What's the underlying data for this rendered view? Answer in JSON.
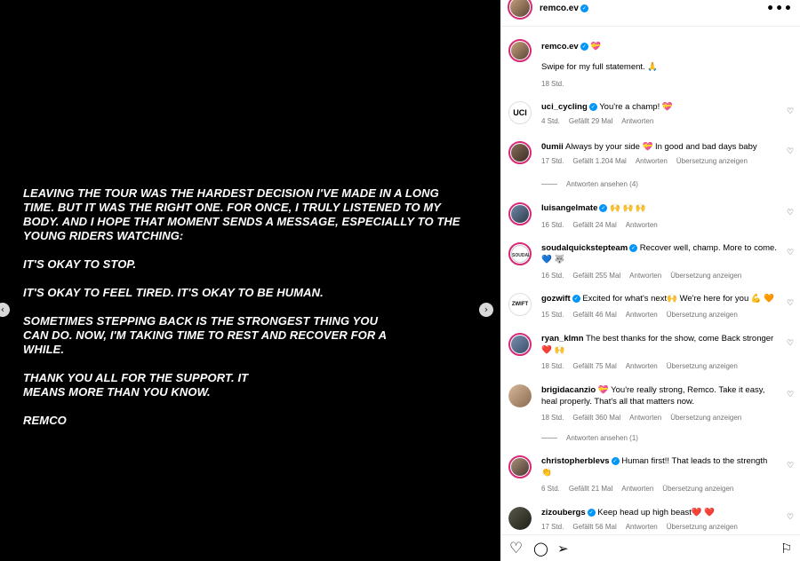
{
  "post": {
    "statement": [
      "LEAVING THE TOUR WAS THE HARDEST DECISION I'VE MADE IN A LONG TIME. BUT IT WAS THE RIGHT ONE. FOR ONCE, I TRULY LISTENED TO MY BODY. AND I HOPE THAT MOMENT SENDS A MESSAGE, ESPECIALLY TO THE YOUNG RIDERS WATCHING:",
      "IT'S OKAY TO STOP.",
      "IT'S OKAY TO FEEL TIRED. IT'S OKAY TO BE HUMAN.",
      "SOMETIMES STEPPING BACK IS THE STRONGEST THING YOU CAN DO. NOW, I'M TAKING TIME TO REST AND RECOVER FOR A WHILE.",
      "THANK YOU ALL FOR THE SUPPORT. IT MEANS MORE THAN YOU KNOW.",
      "REMCO"
    ],
    "prev_icon": "‹",
    "next_icon": "›"
  },
  "header": {
    "username": "remco.ev",
    "more": "•••"
  },
  "caption": {
    "username": "remco.ev",
    "title_emoji": "💝",
    "text": "Swipe for my full statement. 🙏",
    "time": "18 Std."
  },
  "comments": [
    {
      "user": "uci_cycling",
      "verified": true,
      "text": "You're a champ! 💝",
      "time": "4 Std.",
      "likes": "Gefällt 29 Mal",
      "reply": "Antworten",
      "translate": ""
    },
    {
      "user": "0umii",
      "verified": false,
      "text": "Always by your side 💝 In good and bad days baby",
      "time": "17 Std.",
      "likes": "Gefällt 1.204 Mal",
      "reply": "Antworten",
      "translate": "Übersetzung anzeigen"
    },
    {
      "user": "luisangelmate",
      "verified": true,
      "text": "🙌 🙌 🙌",
      "time": "16 Std.",
      "likes": "Gefällt 24 Mal",
      "reply": "Antworten",
      "translate": ""
    },
    {
      "user": "soudalquickstepteam",
      "verified": true,
      "text": "Recover well, champ. More to come. 💙 🐺",
      "time": "16 Std.",
      "likes": "Gefällt 255 Mal",
      "reply": "Antworten",
      "translate": "Übersetzung anzeigen"
    },
    {
      "user": "gozwift",
      "verified": true,
      "text": "Excited for what's next🙌 We're here for you 💪 🧡",
      "time": "15 Std.",
      "likes": "Gefällt 46 Mal",
      "reply": "Antworten",
      "translate": "Übersetzung anzeigen"
    },
    {
      "user": "ryan_klmn",
      "verified": false,
      "text": "The best thanks for the show, come Back stronger ❤️ 🙌",
      "time": "18 Std.",
      "likes": "Gefällt 75 Mal",
      "reply": "Antworten",
      "translate": "Übersetzung anzeigen"
    },
    {
      "user": "brigidacanzio",
      "verified": false,
      "text": "💝 You're really strong, Remco. Take it easy, heal properly. That's all that matters now.",
      "time": "18 Std.",
      "likes": "Gefällt 360 Mal",
      "reply": "Antworten",
      "translate": "Übersetzung anzeigen"
    },
    {
      "user": "christopherblevs",
      "verified": true,
      "text": "Human first!! That leads to the strength 👏",
      "time": "6 Std.",
      "likes": "Gefällt 21 Mal",
      "reply": "Antworten",
      "translate": "Übersetzung anzeigen"
    },
    {
      "user": "zizoubergs",
      "verified": true,
      "text": "Keep head up high beast❤️ ❤️",
      "time": "17 Std.",
      "likes": "Gefällt 56 Mal",
      "reply": "Antworten",
      "translate": "Übersetzung anzeigen"
    }
  ],
  "view_replies": [
    "Antworten ansehen (4)",
    "Antworten ansehen (1)"
  ],
  "footer": {
    "like_icon": "♡",
    "comment_icon": "◯",
    "share_icon": "➢",
    "save_icon": "⚐"
  },
  "colors": {
    "verified": "#0095f6",
    "meta": "#737373",
    "ring": "#d62976"
  }
}
